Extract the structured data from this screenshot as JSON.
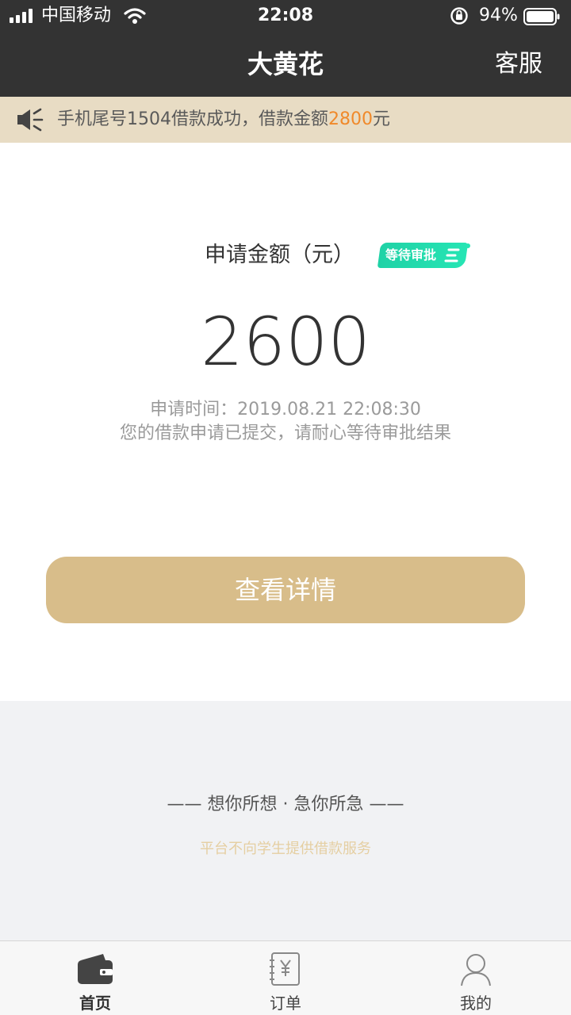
{
  "status_bar": {
    "carrier": "中国移动",
    "time": "22:08",
    "battery": "94%"
  },
  "nav": {
    "title": "大黄花",
    "right_label": "客服"
  },
  "notice": {
    "prefix": "手机尾号1504借款成功，借款金额",
    "amount": "2800",
    "suffix": "元",
    "amount_color": "#f0892a"
  },
  "application": {
    "label": "申请金额（元）",
    "status_badge": "等待审批",
    "amount": "2600",
    "time_line": "申请时间：2019.08.21 22:08:30",
    "note": "您的借款申请已提交，请耐心等待审批结果",
    "detail_button": "查看详情",
    "accent_color": "#d8bd8a",
    "badge_color": "#1fd2a6"
  },
  "footer": {
    "slogan": "—— 想你所想 · 急你所急 ——",
    "disclaimer": "平台不向学生提供借款服务"
  },
  "tabs": [
    {
      "label": "首页",
      "icon": "wallet-icon",
      "active": true
    },
    {
      "label": "订单",
      "icon": "order-yen-icon",
      "active": false
    },
    {
      "label": "我的",
      "icon": "user-icon",
      "active": false
    }
  ]
}
